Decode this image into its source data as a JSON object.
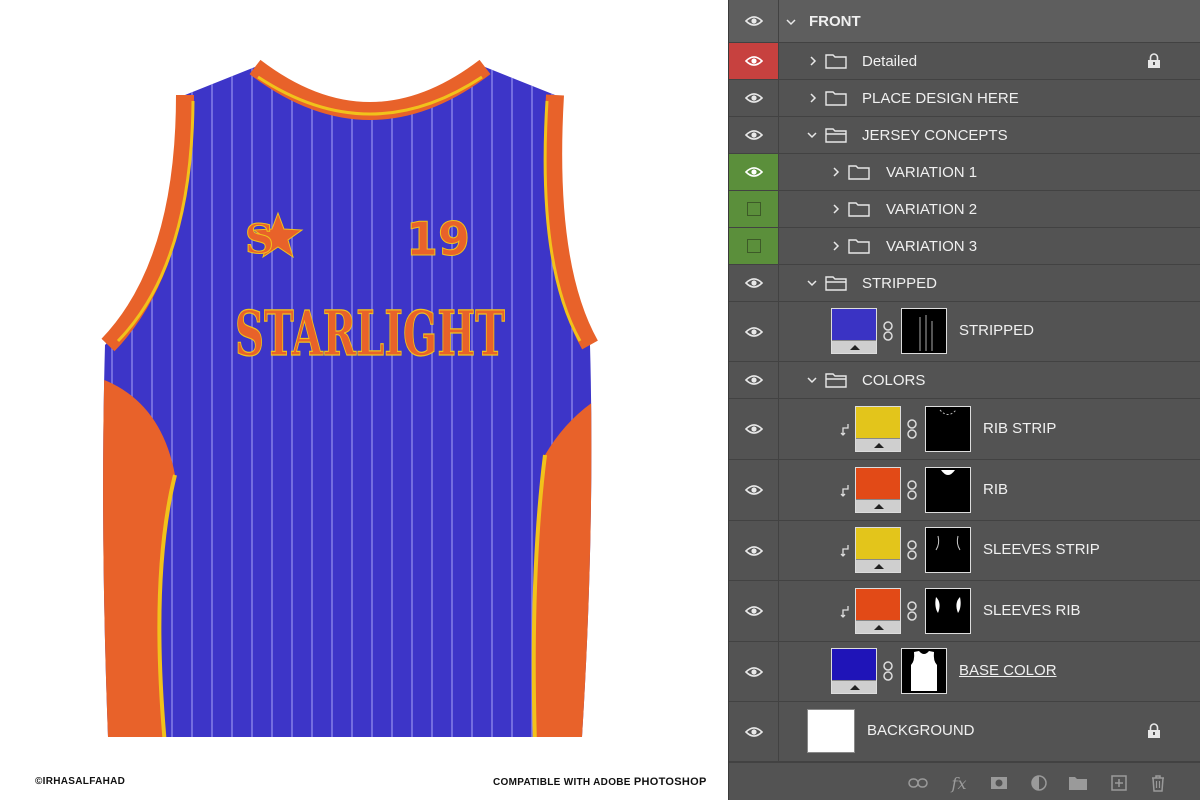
{
  "mockup": {
    "jersey": {
      "number": "19",
      "team_name": "STARLIGHT",
      "logo_letter": "S",
      "colors": {
        "base": "#3d35c8",
        "rib": "#e8622a",
        "strip": "#f1c21b",
        "pinstripe": "#7d78e6"
      }
    },
    "credit_left": "©IRHASALFAHAD",
    "credit_right_prefix": "COMPATIBLE WITH ADOBE",
    "credit_right_brand": "PHOTOSHOP"
  },
  "layers_panel": {
    "group_title": "FRONT",
    "layers": [
      {
        "name": "Detailed",
        "kind": "folder",
        "eye": "red",
        "locked": true
      },
      {
        "name": "PLACE DESIGN HERE",
        "kind": "folder",
        "eye": "visible"
      },
      {
        "name": "JERSEY CONCEPTS",
        "kind": "folder",
        "expanded": true,
        "eye": "visible"
      },
      {
        "name": "VARIATION 1",
        "kind": "folder",
        "eye": "green-visible"
      },
      {
        "name": "VARIATION 2",
        "kind": "folder",
        "eye": "green-hidden"
      },
      {
        "name": "VARIATION 3",
        "kind": "folder",
        "eye": "green-hidden"
      },
      {
        "name": "STRIPPED",
        "kind": "folder",
        "expanded": true,
        "eye": "visible"
      },
      {
        "name": "STRIPPED",
        "kind": "fill",
        "swatch": "#3a33c4",
        "eye": "visible"
      },
      {
        "name": "COLORS",
        "kind": "folder",
        "expanded": true,
        "eye": "visible"
      },
      {
        "name": "RIB STRIP",
        "kind": "fill",
        "swatch": "#e3c51b",
        "clipped": true,
        "eye": "visible"
      },
      {
        "name": "RIB",
        "kind": "fill",
        "swatch": "#e24a17",
        "clipped": true,
        "eye": "visible"
      },
      {
        "name": "SLEEVES STRIP",
        "kind": "fill",
        "swatch": "#e3c51b",
        "clipped": true,
        "eye": "visible"
      },
      {
        "name": "SLEEVES RIB",
        "kind": "fill",
        "swatch": "#e24a17",
        "clipped": true,
        "eye": "visible"
      },
      {
        "name": "BASE COLOR",
        "kind": "fill",
        "swatch": "#1f14b8",
        "eye": "visible"
      },
      {
        "name": "BACKGROUND",
        "kind": "background",
        "locked": true,
        "eye": "visible"
      }
    ],
    "footer_icons": [
      "link-icon",
      "fx-icon",
      "mask-icon",
      "adjustment-icon",
      "new-group-icon",
      "new-layer-icon",
      "trash-icon"
    ],
    "footer_fx_label": "fx"
  }
}
